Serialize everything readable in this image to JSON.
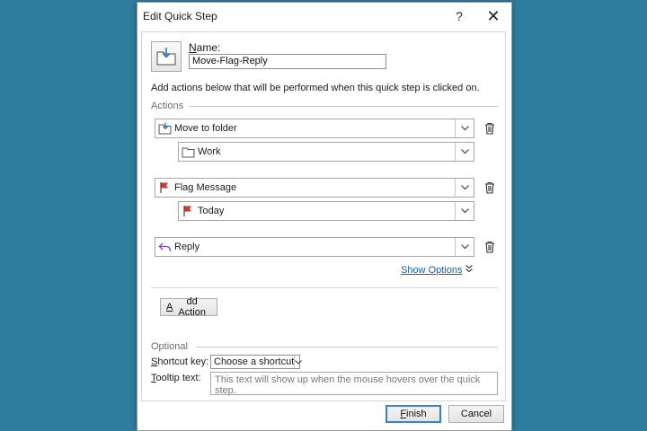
{
  "dialog": {
    "title": "Edit Quick Step",
    "help_label": "?",
    "close_label": "✕"
  },
  "name": {
    "label_accel": "N",
    "label_rest": "ame:",
    "value": "Move-Flag-Reply"
  },
  "instructions": "Add actions below that will be performed when this quick step is clicked on.",
  "actions_section_label": "Actions",
  "actions": [
    {
      "label": "Move to folder",
      "icon": "move-to-folder-icon",
      "sub_value": "Work",
      "sub_icon": "folder-icon"
    },
    {
      "label": "Flag Message",
      "icon": "flag-icon",
      "sub_value": "Today",
      "sub_icon": "flag-icon"
    },
    {
      "label": "Reply",
      "icon": "reply-icon"
    }
  ],
  "show_options_label": "Show Options",
  "add_action": {
    "accel": "A",
    "rest": "dd Action"
  },
  "optional_section_label": "Optional",
  "shortcut": {
    "label_accel": "S",
    "label_rest": "hortcut key:",
    "value": "Choose a shortcut"
  },
  "tooltip": {
    "label_accel": "T",
    "label_rest": "ooltip text:",
    "placeholder": "This text will show up when the mouse hovers over the quick step."
  },
  "footer": {
    "finish_accel": "F",
    "finish_rest": "inish",
    "cancel_label": "Cancel"
  },
  "colors": {
    "background": "#2e7d9e",
    "flag_red": "#d9342b",
    "reply_purple": "#8a3fb5",
    "link_blue": "#1f5fa8"
  }
}
